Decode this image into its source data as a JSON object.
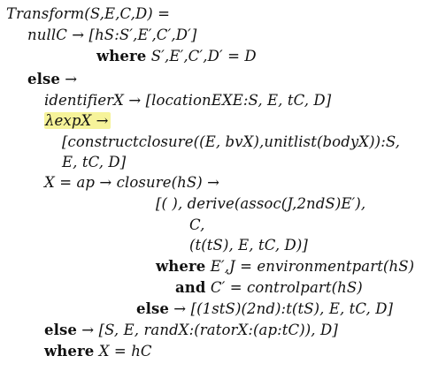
{
  "title": "Transform(S,E,C,D) =",
  "lines": [
    {
      "segments": [
        "nullC → [hS:S′,E′,C′,D′]"
      ]
    },
    {
      "segments": [
        "where",
        " S′,E′,C′,D′ = D"
      ]
    },
    {
      "segments": [
        "else",
        " →"
      ]
    },
    {
      "segments": [
        "identifierX → [locationEXE:S, E, tC, D]"
      ]
    },
    {
      "segments": [
        "λexpX →"
      ]
    },
    {
      "segments": [
        "[constructclosure((E, bvX),unitlist(bodyX)):S,"
      ]
    },
    {
      "segments": [
        "E, tC, D]"
      ]
    },
    {
      "segments": [
        "X = ap → closure(hS) →"
      ]
    },
    {
      "segments": [
        "[( ), derive(assoc(J,2ndS)E′),"
      ]
    },
    {
      "segments": [
        "C,"
      ]
    },
    {
      "segments": [
        "(t(tS), E, tC, D)]"
      ]
    },
    {
      "segments": [
        "where",
        " E′,J = environmentpart(hS)"
      ]
    },
    {
      "segments": [
        "and",
        " C′ = controlpart(hS)"
      ]
    },
    {
      "segments": [
        "else",
        " → [(1stS)(2nd):t(tS), E, tC, D]"
      ]
    },
    {
      "segments": [
        "else",
        " → [S, E, randX:(ratorX:(ap:tC)), D]"
      ]
    },
    {
      "segments": [
        "where",
        " X = hC"
      ]
    }
  ],
  "highlight_color": "#f6f39a"
}
